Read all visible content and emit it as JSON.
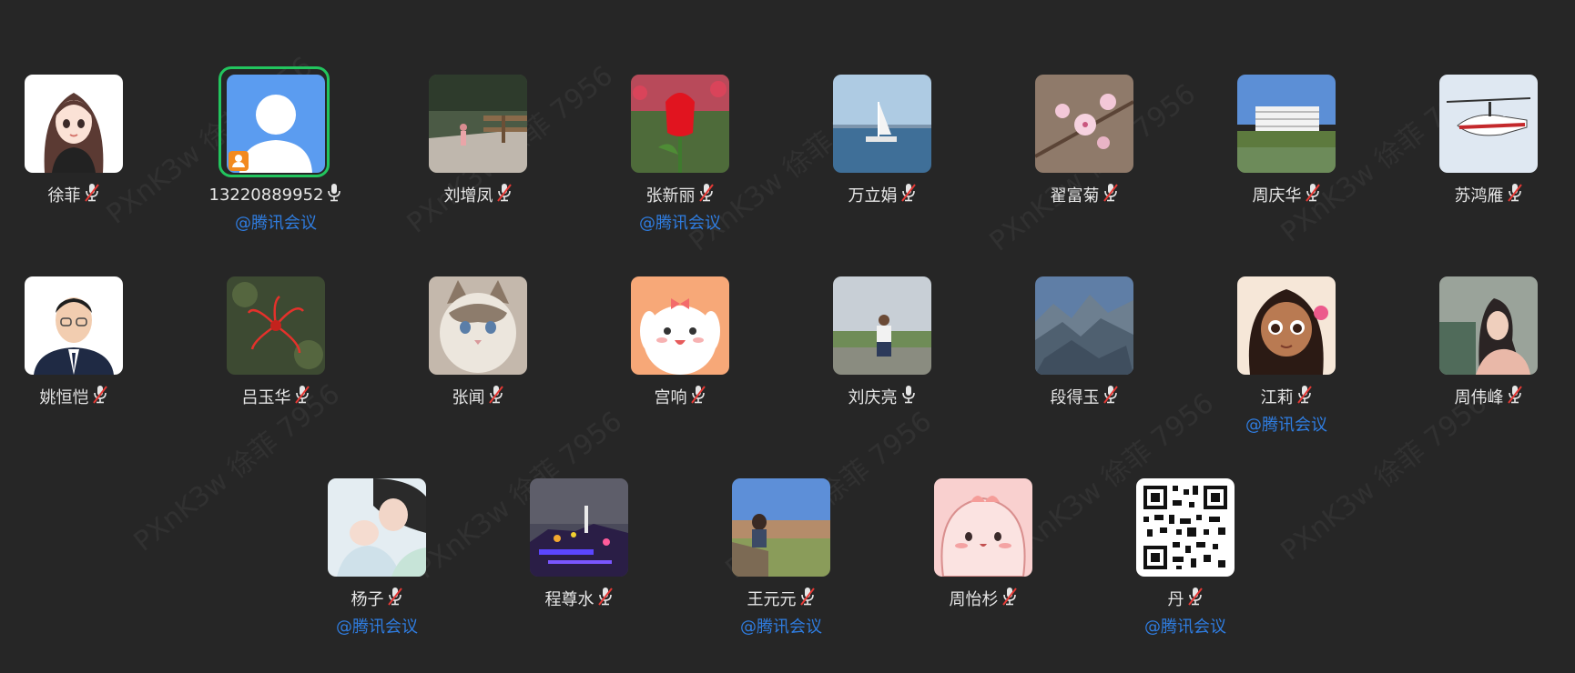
{
  "watermark_text": "PXnK3w 徐菲 7956",
  "org_tag": "@腾讯会议",
  "participants": [
    {
      "name": "徐菲",
      "mic": "muted",
      "tag": "",
      "avatar": "woman-cartoon"
    },
    {
      "name": "13220889952",
      "mic": "on",
      "tag": "@腾讯会议",
      "avatar": "default-person",
      "speaking": true,
      "host": true
    },
    {
      "name": "刘增凤",
      "mic": "muted",
      "tag": "",
      "avatar": "trail-photo"
    },
    {
      "name": "张新丽",
      "mic": "muted",
      "tag": "@腾讯会议",
      "avatar": "tulip-photo"
    },
    {
      "name": "万立娟",
      "mic": "muted",
      "tag": "",
      "avatar": "sailboat-photo"
    },
    {
      "name": "翟富菊",
      "mic": "muted",
      "tag": "",
      "avatar": "blossom-photo"
    },
    {
      "name": "周庆华",
      "mic": "muted",
      "tag": "",
      "avatar": "building-photo"
    },
    {
      "name": "苏鸿雁",
      "mic": "muted",
      "tag": "",
      "avatar": "helicopter-photo"
    },
    {
      "name": "姚恒恺",
      "mic": "muted",
      "tag": "",
      "avatar": "man-portrait"
    },
    {
      "name": "吕玉华",
      "mic": "muted",
      "tag": "",
      "avatar": "red-flower-photo"
    },
    {
      "name": "张闻",
      "mic": "muted",
      "tag": "",
      "avatar": "cat-photo"
    },
    {
      "name": "宫响",
      "mic": "muted",
      "tag": "",
      "avatar": "puppy-cartoon"
    },
    {
      "name": "刘庆亮",
      "mic": "on",
      "tag": "",
      "avatar": "man-outdoor-photo"
    },
    {
      "name": "段得玉",
      "mic": "muted",
      "tag": "",
      "avatar": "mountain-photo"
    },
    {
      "name": "江莉",
      "mic": "muted",
      "tag": "@腾讯会议",
      "avatar": "moana-cartoon"
    },
    {
      "name": "周伟峰",
      "mic": "muted",
      "tag": "",
      "avatar": "woman-sleeping-photo"
    },
    {
      "name": "杨子",
      "mic": "muted",
      "tag": "@腾讯会议",
      "avatar": "mother-baby-photo"
    },
    {
      "name": "程尊水",
      "mic": "muted",
      "tag": "",
      "avatar": "night-lights-photo"
    },
    {
      "name": "王元元",
      "mic": "muted",
      "tag": "@腾讯会议",
      "avatar": "city-view-photo"
    },
    {
      "name": "周怡杉",
      "mic": "muted",
      "tag": "",
      "avatar": "pink-blob-cartoon"
    },
    {
      "name": "丹",
      "mic": "muted",
      "tag": "@腾讯会议",
      "avatar": "qr-code"
    }
  ],
  "colors": {
    "background": "#262626",
    "name_text": "#e6e6e6",
    "tag_text": "#2f7de1",
    "speaking_ring": "#22c55e",
    "mute_slash": "#e53935"
  }
}
